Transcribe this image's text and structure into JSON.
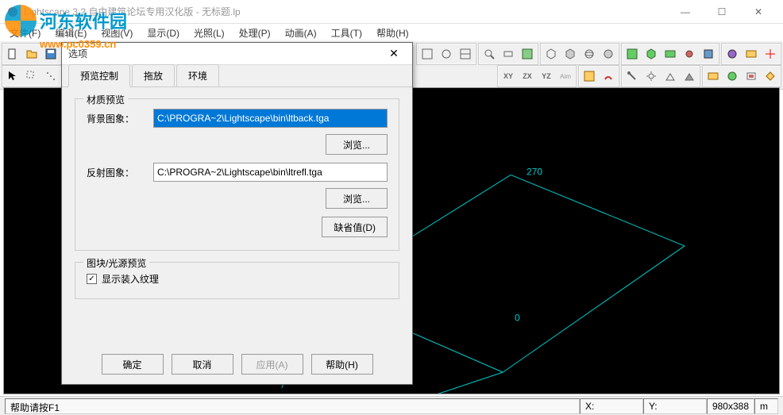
{
  "window": {
    "title": "Lightscape 3.2 自由建筑论坛专用汉化版  - 无标题.lp"
  },
  "menu": {
    "file": "文件(F)",
    "edit": "编辑(E)",
    "view": "视图(V)",
    "display": "显示(D)",
    "lighting": "光照(L)",
    "process": "处理(P)",
    "animation": "动画(A)",
    "tools": "工具(T)",
    "help": "帮助(H)"
  },
  "watermark": {
    "text": "河东软件园",
    "url": "www.pc0359.cn"
  },
  "canvas": {
    "label_top": "270",
    "label_bottom": "0"
  },
  "status": {
    "help": "帮助请按F1",
    "x": "X:",
    "y": "Y:",
    "size": "980x388",
    "unit": "m"
  },
  "dialog": {
    "title": "选项",
    "tabs": {
      "preview": "预览控制",
      "scale": "拖放",
      "env": "环境"
    },
    "material_group": "材质预览",
    "bg_label": "背景图象：",
    "bg_value": "C:\\PROGRA~2\\Lightscape\\bin\\ltback.tga",
    "refl_label": "反射图象：",
    "refl_value": "C:\\PROGRA~2\\Lightscape\\bin\\ltrefl.tga",
    "browse": "浏览...",
    "defaults": "缺省值(D)",
    "block_group": "图块/光源预览",
    "show_textures": "显示装入纹理",
    "show_textures_checked": true,
    "ok": "确定",
    "cancel": "取消",
    "apply": "应用(A)",
    "help": "帮助(H)"
  }
}
